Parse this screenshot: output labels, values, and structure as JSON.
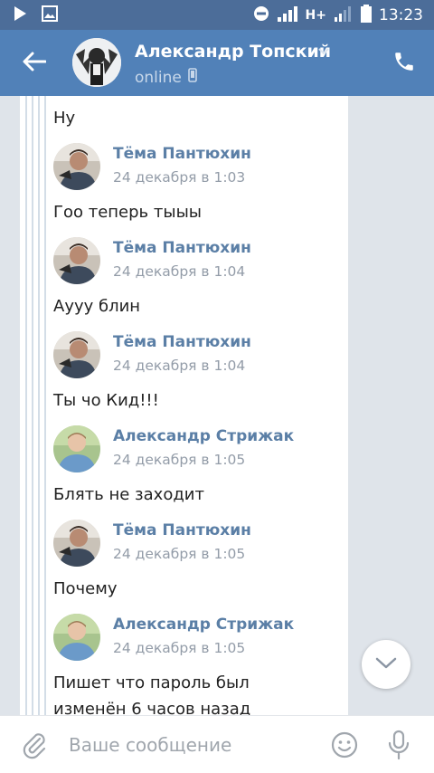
{
  "status_bar": {
    "time": "13:23",
    "network": "H+",
    "icons": [
      "play-icon",
      "image-icon",
      "do-not-disturb-icon",
      "signal-icon",
      "battery-icon"
    ]
  },
  "header": {
    "back_icon": "arrow-left-icon",
    "title": "Александр Топский",
    "status": "online",
    "status_icon": "mobile-icon",
    "call_icon": "phone-icon"
  },
  "messages": [
    {
      "type": "text",
      "text": "Ну"
    },
    {
      "type": "author",
      "name": "Тёма Пантюхин",
      "date": "24 декабря в 1:03",
      "avatar": "tema"
    },
    {
      "type": "text",
      "text": "Гоо теперь тыыы"
    },
    {
      "type": "author",
      "name": "Тёма Пантюхин",
      "date": "24 декабря в 1:04",
      "avatar": "tema"
    },
    {
      "type": "text",
      "text": "Аууу блин"
    },
    {
      "type": "author",
      "name": "Тёма Пантюхин",
      "date": "24 декабря в 1:04",
      "avatar": "tema"
    },
    {
      "type": "text",
      "text": "Ты чо Кид!!!"
    },
    {
      "type": "author",
      "name": "Александр Стрижак",
      "date": "24 декабря в 1:05",
      "avatar": "alex"
    },
    {
      "type": "text",
      "text": "Блять не заходит"
    },
    {
      "type": "author",
      "name": "Тёма Пантюхин",
      "date": "24 декабря в 1:05",
      "avatar": "tema"
    },
    {
      "type": "text",
      "text": "Почему"
    },
    {
      "type": "author",
      "name": "Александр Стрижак",
      "date": "24 декабря в 1:05",
      "avatar": "alex"
    },
    {
      "type": "text",
      "text": "Пишет что пароль был"
    },
    {
      "type": "text",
      "text": "изменён 6 часов назад"
    }
  ],
  "composer": {
    "placeholder": "Ваше сообщение",
    "attach_icon": "paperclip-icon",
    "emoji_icon": "smile-icon",
    "mic_icon": "microphone-icon"
  },
  "scroll_down_icon": "chevron-down-icon",
  "colors": {
    "header": "#5181b8",
    "status_bar": "#4c6d99",
    "author_name": "#5b7fa6",
    "date": "#939ca8"
  }
}
